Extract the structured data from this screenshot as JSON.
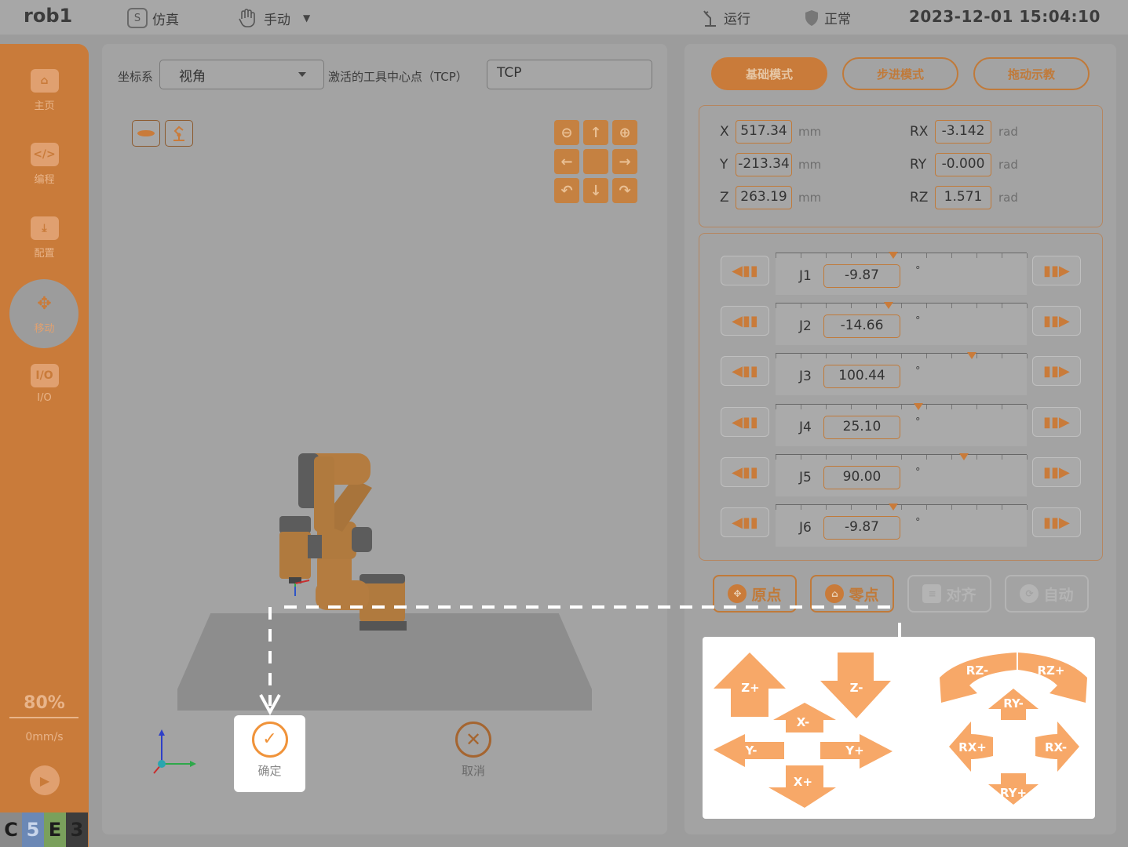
{
  "topbar": {
    "robot_name": "rob1",
    "sim_label": "仿真",
    "manual_label": "手动",
    "run_label": "运行",
    "status_label": "正常",
    "datetime": "2023-12-01 15:04:10"
  },
  "sidebar": {
    "items": [
      {
        "label": "主页"
      },
      {
        "label": "编程"
      },
      {
        "label": "配置"
      },
      {
        "label": "移动"
      },
      {
        "label": "I/O"
      }
    ],
    "io_icon_text": "I/O",
    "speed_percent": "80%",
    "speed_value": "0mm/s",
    "badges": [
      "C",
      "5",
      "E",
      "3"
    ]
  },
  "center": {
    "coord_label": "坐标系",
    "coord_value": "视角",
    "tcp_label": "激活的工具中心点（TCP）",
    "tcp_value": "TCP",
    "confirm_label": "确定",
    "cancel_label": "取消"
  },
  "right": {
    "modes": [
      "基础模式",
      "步进模式",
      "拖动示教"
    ],
    "active_mode": "基础模式",
    "coords": [
      {
        "axis": "X",
        "value": "517.34",
        "unit": "mm"
      },
      {
        "axis": "Y",
        "value": "-213.34",
        "unit": "mm"
      },
      {
        "axis": "Z",
        "value": "263.19",
        "unit": "mm"
      },
      {
        "axis": "RX",
        "value": "-3.142",
        "unit": "rad"
      },
      {
        "axis": "RY",
        "value": "-0.000",
        "unit": "rad"
      },
      {
        "axis": "RZ",
        "value": "1.571",
        "unit": "rad"
      }
    ],
    "joints": [
      {
        "name": "J1",
        "value": "-9.87",
        "unit": "°",
        "marker_level": 0.47
      },
      {
        "name": "J2",
        "value": "-14.66",
        "unit": "°",
        "marker_level": 0.45
      },
      {
        "name": "J3",
        "value": "100.44",
        "unit": "°",
        "marker_level": 0.78
      },
      {
        "name": "J4",
        "value": "25.10",
        "unit": "°",
        "marker_level": 0.57
      },
      {
        "name": "J5",
        "value": "90.00",
        "unit": "°",
        "marker_level": 0.75
      },
      {
        "name": "J6",
        "value": "-9.87",
        "unit": "°",
        "marker_level": 0.47
      }
    ],
    "actions": [
      {
        "label": "原点",
        "enabled": true
      },
      {
        "label": "零点",
        "enabled": true
      },
      {
        "label": "对齐",
        "enabled": false
      },
      {
        "label": "自动",
        "enabled": false
      }
    ]
  },
  "legend": {
    "translation": [
      "Z+",
      "Z-",
      "X-",
      "Y-",
      "Y+",
      "X+"
    ],
    "rotation": [
      "RZ-",
      "RZ+",
      "RY-",
      "RX+",
      "RX-",
      "RY+"
    ]
  },
  "colors": {
    "accent": "#c97b3a",
    "arrow": "#f7a868",
    "confirm": "#f0933a"
  }
}
